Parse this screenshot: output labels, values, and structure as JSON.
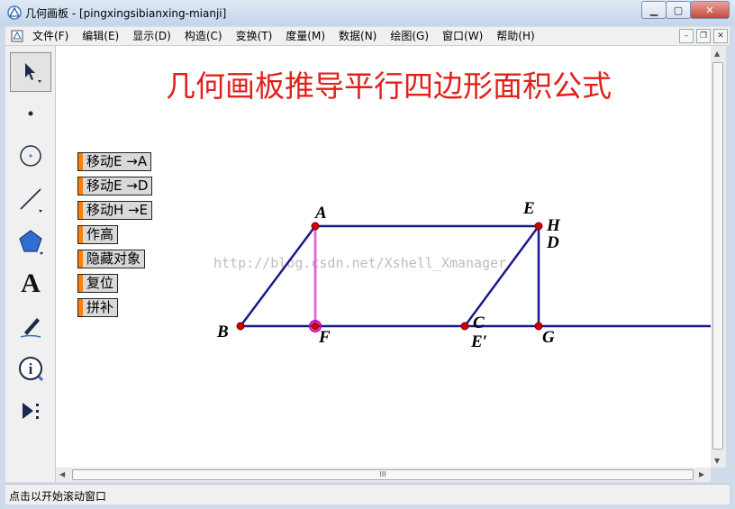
{
  "window": {
    "title": "几何画板 - [pingxingsibianxing-mianji]",
    "buttons": {
      "minimize": "▁",
      "maximize": "▢",
      "close": "✕"
    }
  },
  "menu": {
    "items": [
      "文件(F)",
      "编辑(E)",
      "显示(D)",
      "构造(C)",
      "变换(T)",
      "度量(M)",
      "数据(N)",
      "绘图(G)",
      "窗口(W)",
      "帮助(H)"
    ],
    "mdi_buttons": [
      "–",
      "❐",
      "✕"
    ]
  },
  "toolbox": {
    "tools": [
      {
        "icon": "arrow-select-icon"
      },
      {
        "icon": "point-icon"
      },
      {
        "icon": "compass-icon"
      },
      {
        "icon": "straightedge-icon"
      },
      {
        "icon": "polygon-icon"
      },
      {
        "icon": "text-icon",
        "glyph": "A"
      },
      {
        "icon": "marker-icon"
      },
      {
        "icon": "information-icon",
        "glyph": "i"
      },
      {
        "icon": "custom-tool-icon"
      }
    ]
  },
  "canvas": {
    "heading": "几何画板推导平行四边形面积公式",
    "watermark": "http://blog.csdn.net/Xshell_Xmanager",
    "buttons": [
      "移动E →A",
      "移动E →D",
      "移动H →E",
      "作高",
      "隐藏对象",
      "复位",
      "拼补"
    ],
    "point_labels": {
      "A": "A",
      "B": "B",
      "C": "C",
      "D": "D",
      "E": "E",
      "E_prime": "E′",
      "F": "F",
      "G": "G",
      "H": "H"
    }
  },
  "colors": {
    "heading": "#e0211b",
    "segment": "#1a1a8c",
    "altitude": "#cc00cc",
    "point": "#cc0000",
    "button_marker": "#ff7f00",
    "watermark": "#bdbdbd"
  },
  "scrollbar": {
    "grip": "III"
  },
  "status": {
    "text": "点击以开始滚动窗口"
  }
}
